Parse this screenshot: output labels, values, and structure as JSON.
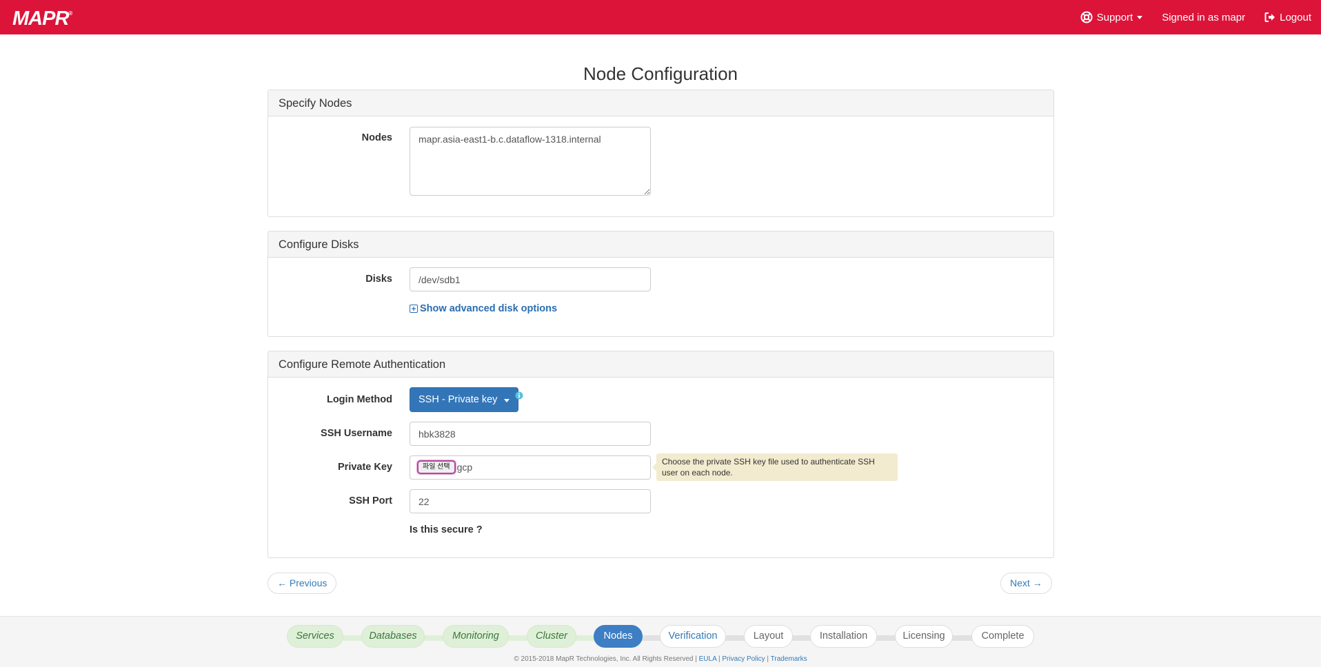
{
  "navbar": {
    "logo": "MAPR",
    "logo_mark": "®",
    "support_label": "Support",
    "signed_in": "Signed in as mapr",
    "logout_label": "Logout"
  },
  "page": {
    "title": "Node Configuration"
  },
  "specify_nodes": {
    "heading": "Specify Nodes",
    "nodes_label": "Nodes",
    "nodes_value": "mapr.asia-east1-b.c.dataflow-1318.internal"
  },
  "configure_disks": {
    "heading": "Configure Disks",
    "disks_label": "Disks",
    "disks_value": "/dev/sdb1",
    "advanced_link": "Show advanced disk options"
  },
  "remote_auth": {
    "heading": "Configure Remote Authentication",
    "login_method_label": "Login Method",
    "login_method_value": "SSH - Private key",
    "ssh_username_label": "SSH Username",
    "ssh_username_value": "hbk3828",
    "private_key_label": "Private Key",
    "file_button": "파일 선택",
    "file_name": "gcp",
    "tooltip": "Choose the private SSH key file used to authenticate SSH user on each node.",
    "ssh_port_label": "SSH Port",
    "ssh_port_value": "22",
    "secure_link": "Is this secure ?"
  },
  "pager": {
    "previous": "← Previous",
    "next": "Next →"
  },
  "steps": [
    {
      "label": "Services",
      "state": "done"
    },
    {
      "label": "Databases",
      "state": "done"
    },
    {
      "label": "Monitoring",
      "state": "done"
    },
    {
      "label": "Cluster",
      "state": "done"
    },
    {
      "label": "Nodes",
      "state": "active"
    },
    {
      "label": "Verification",
      "state": "next"
    },
    {
      "label": "Layout",
      "state": "pending"
    },
    {
      "label": "Installation",
      "state": "pending"
    },
    {
      "label": "Licensing",
      "state": "pending"
    },
    {
      "label": "Complete",
      "state": "pending"
    }
  ],
  "footer": {
    "copyright": "© 2015-2018 MapR Technologies, Inc. All Rights Reserved |",
    "eula": "EULA",
    "sep1": "|",
    "privacy": "Privacy Policy",
    "sep2": "|",
    "trademarks": "Trademarks"
  },
  "colors": {
    "brand": "#dc1439",
    "primary": "#3376b8",
    "done_step": "#dff0d8",
    "tooltip_bg": "#f3ebcf"
  },
  "icons": {
    "support": "lifebuoy-icon",
    "logout": "logout-icon",
    "advanced": "plus-square-icon",
    "info": "info-circle-icon"
  }
}
